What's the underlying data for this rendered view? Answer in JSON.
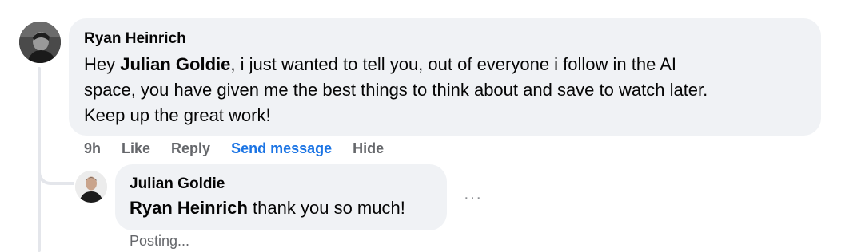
{
  "comment": {
    "author": "Ryan Heinrich",
    "text_prefix": "Hey ",
    "mention": "Julian Goldie",
    "text_line1_rest": ", i just wanted to tell you, out of everyone i follow in the AI",
    "text_line2": "space, you have given me the best things to think about and save to watch later.",
    "text_line3": "Keep up the great work!",
    "time": "9h",
    "like_label": "Like",
    "reply_label": "Reply",
    "send_message_label": "Send message",
    "hide_label": "Hide"
  },
  "reply": {
    "author": "Julian Goldie",
    "mention": "Ryan Heinrich",
    "text_rest": " thank you so much!",
    "more_label": "···",
    "status": "Posting..."
  },
  "colors": {
    "bubble": "#f0f2f5",
    "accent": "#1b74e4",
    "secondary_text": "#65676b",
    "thread_line": "#e4e6eb"
  }
}
